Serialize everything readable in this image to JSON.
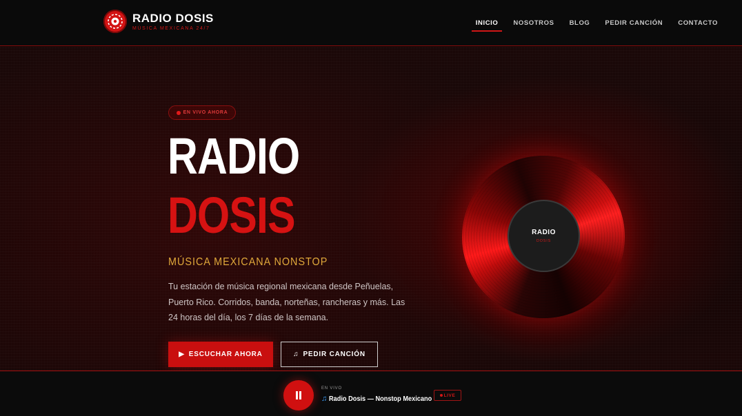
{
  "brand": {
    "name": "RADIO DOSIS",
    "tagline": "MÚSICA MEXICANA 24/7",
    "logo_icon": "radio-disc-icon",
    "accent_color": "#d01010"
  },
  "nav": {
    "items": [
      {
        "label": "INICIO",
        "active": true
      },
      {
        "label": "NOSOTROS",
        "active": false
      },
      {
        "label": "BLOG",
        "active": false
      },
      {
        "label": "PEDIR CANCIÓN",
        "active": false
      },
      {
        "label": "CONTACTO",
        "active": false
      }
    ]
  },
  "hero": {
    "live_pill": "EN VIVO AHORA",
    "title_line1": "RADIO",
    "title_line2": "DOSIS",
    "subtitle": "MÚSICA MEXICANA NONSTOP",
    "description": "Tu estación de música regional mexicana desde Peñuelas, Puerto Rico. Corridos, banda, norteñas, rancheras y más. Las 24 horas del día, los 7 días de la semana.",
    "primary_button": {
      "label": "ESCUCHAR AHORA",
      "icon": "play-icon",
      "glyph": "▶"
    },
    "secondary_button": {
      "label": "PEDIR CANCIÓN",
      "icon": "music-note-icon",
      "glyph": "♫"
    },
    "vinyl": {
      "label_line1": "RADIO",
      "label_line2": "DOSIS"
    }
  },
  "player": {
    "status_label": "EN VIVO",
    "track_icon": "music-note-icon",
    "track_glyph": "♫",
    "track_title": "Radio Dosis — Nonstop Mexicano",
    "badge": "LIVE",
    "state": "playing"
  }
}
